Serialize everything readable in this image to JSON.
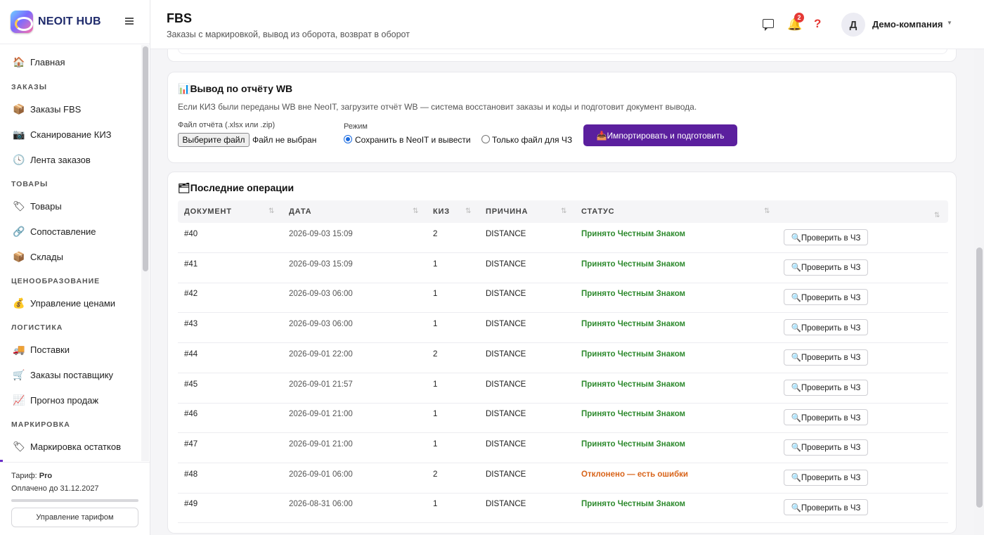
{
  "brand": {
    "name": "NEOIT HUB"
  },
  "sidebar": {
    "items": [
      {
        "icon": "🏠",
        "label": "Главная"
      },
      {
        "section": "ЗАКАЗЫ"
      },
      {
        "icon": "📦",
        "label": "Заказы FBS"
      },
      {
        "icon": "📷",
        "label": "Сканирование КИЗ"
      },
      {
        "icon": "🕓",
        "label": "Лента заказов"
      },
      {
        "section": "ТОВАРЫ"
      },
      {
        "icon": "🏷",
        "label": "Товары"
      },
      {
        "icon": "🔗",
        "label": "Сопоставление"
      },
      {
        "icon": "📦",
        "label": "Склады"
      },
      {
        "section": "ЦЕНООБРАЗОВАНИЕ"
      },
      {
        "icon": "💰",
        "label": "Управление ценами"
      },
      {
        "section": "ЛОГИСТИКА"
      },
      {
        "icon": "🚚",
        "label": "Поставки"
      },
      {
        "icon": "🛒",
        "label": "Заказы поставщику"
      },
      {
        "icon": "📈",
        "label": "Прогноз продаж"
      },
      {
        "section": "МАРКИРОВКА"
      },
      {
        "icon": "🏷",
        "label": "Маркировка остатков"
      }
    ]
  },
  "tariff": {
    "label": "Тариф:",
    "plan": "Pro",
    "paid_until": "Оплачено до 31.12.2027",
    "manage_label": "Управление тарифом"
  },
  "header": {
    "title": "FBS",
    "subtitle": "Заказы с маркировкой, вывод из оборота, возврат в оборот",
    "notifications_count": "2",
    "help_glyph": "?",
    "avatar_letter": "Д",
    "company": "Демо-компания"
  },
  "report": {
    "icon": "📊",
    "title": "Вывод по отчёту WB",
    "description": "Если КИЗ были переданы WB вне NeoIT, загрузите отчёт WB — система восстановит заказы и коды и подготовит документ вывода.",
    "file_label": "Файл отчёта (.xlsx или .zip)",
    "file_button": "Выберите файл",
    "file_none": "Файл не выбран",
    "mode_label": "Режим",
    "mode_save": "Сохранить в NeoIT и вывести",
    "mode_file_only": "Только файл для ЧЗ",
    "import_icon": "📥",
    "import_label": "Импортировать и подготовить"
  },
  "operations": {
    "icon": "🗂",
    "title": "Последние операции",
    "columns": [
      "ДОКУМЕНТ",
      "ДАТА",
      "КИЗ",
      "ПРИЧИНА",
      "СТАТУС"
    ],
    "check_label": "🔍Проверить в ЧЗ",
    "rows": [
      {
        "doc": "#40",
        "date": "2026-09-03 15:09",
        "kiz": "2",
        "reason": "DISTANCE",
        "status": "Принято Честным Знаком",
        "ok": true
      },
      {
        "doc": "#41",
        "date": "2026-09-03 15:09",
        "kiz": "1",
        "reason": "DISTANCE",
        "status": "Принято Честным Знаком",
        "ok": true
      },
      {
        "doc": "#42",
        "date": "2026-09-03 06:00",
        "kiz": "1",
        "reason": "DISTANCE",
        "status": "Принято Честным Знаком",
        "ok": true
      },
      {
        "doc": "#43",
        "date": "2026-09-03 06:00",
        "kiz": "1",
        "reason": "DISTANCE",
        "status": "Принято Честным Знаком",
        "ok": true
      },
      {
        "doc": "#44",
        "date": "2026-09-01 22:00",
        "kiz": "2",
        "reason": "DISTANCE",
        "status": "Принято Честным Знаком",
        "ok": true
      },
      {
        "doc": "#45",
        "date": "2026-09-01 21:57",
        "kiz": "1",
        "reason": "DISTANCE",
        "status": "Принято Честным Знаком",
        "ok": true
      },
      {
        "doc": "#46",
        "date": "2026-09-01 21:00",
        "kiz": "1",
        "reason": "DISTANCE",
        "status": "Принято Честным Знаком",
        "ok": true
      },
      {
        "doc": "#47",
        "date": "2026-09-01 21:00",
        "kiz": "1",
        "reason": "DISTANCE",
        "status": "Принято Честным Знаком",
        "ok": true
      },
      {
        "doc": "#48",
        "date": "2026-09-01 06:00",
        "kiz": "2",
        "reason": "DISTANCE",
        "status": "Отклонено — есть ошибки",
        "ok": false
      },
      {
        "doc": "#49",
        "date": "2026-08-31 06:00",
        "kiz": "1",
        "reason": "DISTANCE",
        "status": "Принято Честным Знаком",
        "ok": true
      }
    ]
  },
  "colors": {
    "accent": "#5b1f9e",
    "ok": "#2e8a2e",
    "error": "#d8641a",
    "badge": "#e53935"
  }
}
